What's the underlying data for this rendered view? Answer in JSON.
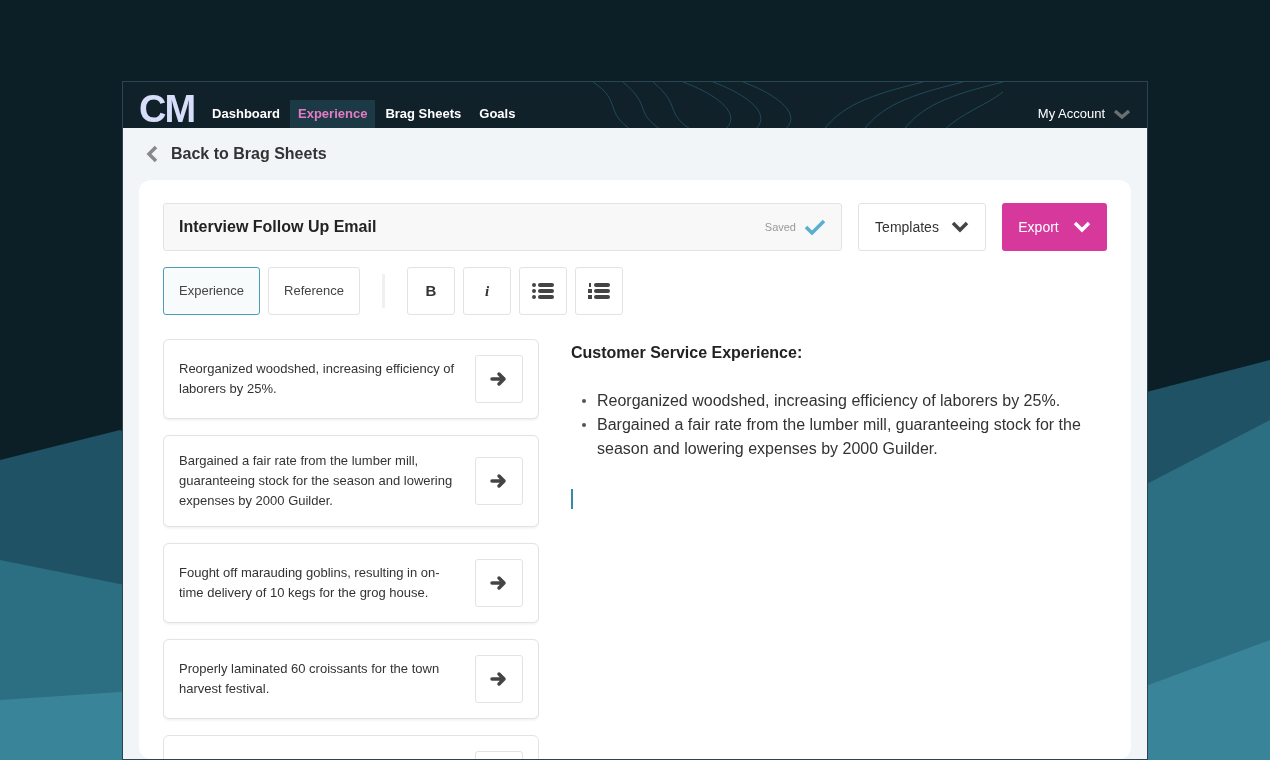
{
  "logo": "CM",
  "nav": [
    {
      "label": "Dashboard",
      "selected": false
    },
    {
      "label": "Experience",
      "selected": true
    },
    {
      "label": "Brag Sheets",
      "selected": false
    },
    {
      "label": "Goals",
      "selected": false
    }
  ],
  "account": "My Account",
  "back_link": "Back to Brag Sheets",
  "document": {
    "title": "Interview Follow Up Email",
    "status": "Saved"
  },
  "templates_button": "Templates",
  "export_button": "Export",
  "source_tabs": [
    {
      "label": "Experience",
      "selected": true
    },
    {
      "label": "Reference",
      "selected": false
    }
  ],
  "format_buttons": [
    {
      "kind": "bold",
      "label": "B"
    },
    {
      "kind": "italic",
      "label": "i"
    },
    {
      "kind": "bullets"
    },
    {
      "kind": "numbers"
    }
  ],
  "experience_cards": [
    {
      "kind": "full",
      "text": "Reorganized woodshed, increasing efficiency of laborers by 25%."
    },
    {
      "kind": "full",
      "text": "Bargained a fair rate from the lumber mill, guaranteeing stock for the season and lowering expenses by 2000 Guilder."
    },
    {
      "kind": "full",
      "text": "Fought off marauding goblins, resulting in on-time delivery of 10 kegs for the grog house."
    },
    {
      "kind": "full",
      "text": "Properly laminated 60 croissants for the town harvest festival."
    },
    {
      "kind": "partial"
    }
  ],
  "editor": {
    "heading": "Customer Service Experience:",
    "bullets": [
      "Reorganized woodshed, increasing efficiency of laborers by 25%.",
      "Bargained a fair rate from the lumber mill, guaranteeing stock for the season and lowering expenses by 2000 Guilder."
    ],
    "cursor": true
  }
}
